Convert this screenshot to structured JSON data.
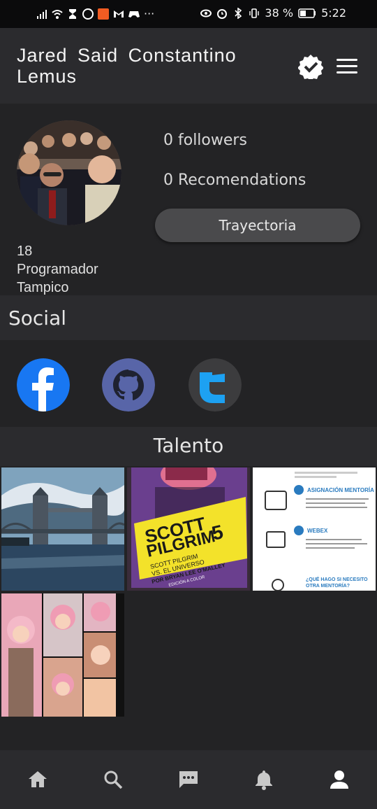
{
  "status_bar": {
    "battery": "38 %",
    "time": "5:22",
    "more": "···"
  },
  "header": {
    "title": "Jared Said Constantino Lemus"
  },
  "profile": {
    "followers": "0 followers",
    "recommendations": "0 Recomendations",
    "button": "Trayectoria",
    "age": "18",
    "occupation": "Programador",
    "city": "Tampico"
  },
  "social": {
    "title": "Social",
    "links": [
      "facebook-icon",
      "github-icon",
      "twitter-icon"
    ]
  },
  "talento": {
    "title": "Talento",
    "items": [
      {
        "type": "photo",
        "subject": "tower-bridge"
      },
      {
        "type": "photo",
        "subject": "book-cover",
        "text": [
          "SCOTT",
          "PILGRIM",
          "5",
          "SCOTT PILGRIM",
          "VS. EL UNIVERSO",
          "POR BRYAN LEE O'MALLEY",
          "EDICIÓN A COLOR"
        ]
      },
      {
        "type": "document",
        "text": [
          "ASIGNACIÓN MENTORÍA",
          "WEBEX",
          "¿QUÉ HAGO SI NECESITO",
          "OTRA MENTORÍA?"
        ]
      },
      {
        "type": "photo",
        "subject": "comic-panels"
      }
    ]
  },
  "bottom_nav": [
    "home-icon",
    "search-icon",
    "chat-icon",
    "bell-icon",
    "person-icon"
  ],
  "colors": {
    "background": "#232325",
    "bar": "#2b2b2e",
    "button": "#4a4a4c",
    "facebook": "#1877f2",
    "github": "#5865a8",
    "twitter": "#1da1f2"
  }
}
